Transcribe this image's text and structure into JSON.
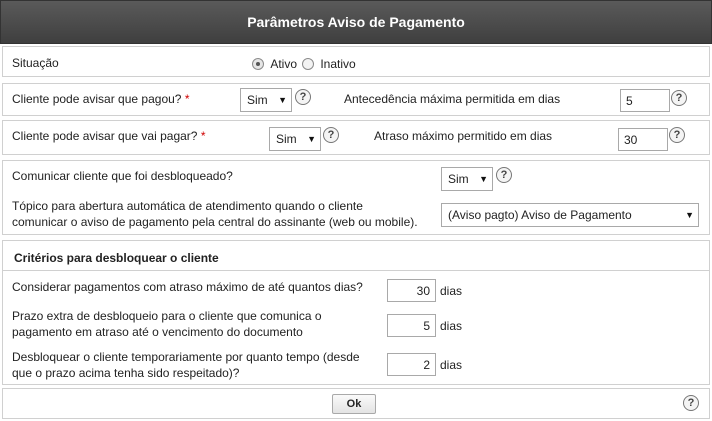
{
  "title": "Parâmetros Aviso de Pagamento",
  "situacao": {
    "label": "Situação",
    "options": [
      "Ativo",
      "Inativo"
    ],
    "selected": "Ativo"
  },
  "row1": {
    "label": "Cliente pode avisar que pagou?",
    "required_mark": "*",
    "select_value": "Sim",
    "right_label": "Antecedência máxima permitida em dias",
    "right_value": "5"
  },
  "row2": {
    "label": "Cliente pode avisar que vai pagar?",
    "required_mark": "*",
    "select_value": "Sim",
    "right_label": "Atraso máximo permitido em dias",
    "right_value": "30"
  },
  "row3": {
    "label": "Comunicar cliente que foi desbloqueado?",
    "select_value": "Sim",
    "topic_label_line1": "Tópico para abertura automática de atendimento quando o cliente",
    "topic_label_line2": "comunicar o aviso de pagamento pela central do assinante (web ou mobile).",
    "topic_value": "(Aviso pagto) Aviso de Pagamento"
  },
  "criterios": {
    "title": "Critérios para desbloquear o cliente",
    "items": [
      {
        "line1": "Considerar pagamentos com atraso máximo de até quantos dias?",
        "line2": "",
        "value": "30",
        "unit": "dias"
      },
      {
        "line1": "Prazo extra de desbloqueio para o cliente que comunica o",
        "line2": "pagamento em atraso até o vencimento do documento",
        "value": "5",
        "unit": "dias"
      },
      {
        "line1": "Desbloquear o cliente temporariamente por quanto tempo (desde",
        "line2": "que o prazo acima tenha sido respeitado)?",
        "value": "2",
        "unit": "dias"
      }
    ]
  },
  "footer": {
    "ok_label": "Ok"
  },
  "icons": {
    "help": "help-icon",
    "caret": "chevron-down-icon"
  },
  "colors": {
    "header_bg": "#4a4a4a",
    "required": "#d00000"
  }
}
